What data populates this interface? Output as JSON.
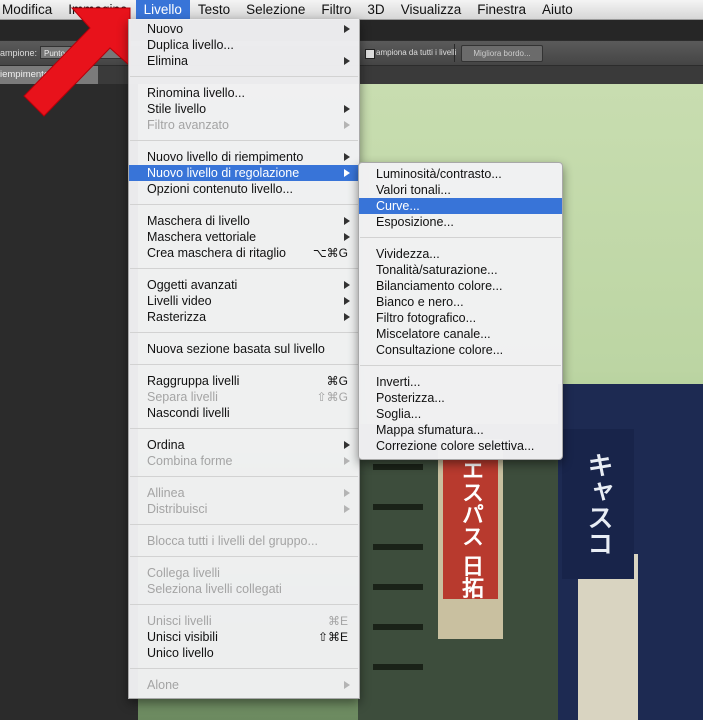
{
  "menubar": {
    "items": [
      "Modifica",
      "Immagine",
      "Livello",
      "Testo",
      "Selezione",
      "Filtro",
      "3D",
      "Visualizza",
      "Finestra",
      "Aiuto"
    ],
    "active": "Livello"
  },
  "options_bar": {
    "sample_label": "ampione:",
    "sample_value": "Punto ca",
    "all_layers_label": "ampiona da tutti i livelli",
    "refine_edge_button": "Migliora bordo..."
  },
  "doc_tab": {
    "title": "iempimento 1"
  },
  "layer_menu": {
    "items": [
      {
        "label": "Nuovo",
        "submenu": true
      },
      {
        "label": "Duplica livello..."
      },
      {
        "label": "Elimina",
        "submenu": true
      },
      {
        "separator": true
      },
      {
        "label": "Rinomina livello..."
      },
      {
        "label": "Stile livello",
        "submenu": true
      },
      {
        "label": "Filtro avanzato",
        "submenu": true,
        "disabled": true
      },
      {
        "separator": true
      },
      {
        "label": "Nuovo livello di riempimento",
        "submenu": true
      },
      {
        "label": "Nuovo livello di regolazione",
        "submenu": true,
        "highlighted": true
      },
      {
        "label": "Opzioni contenuto livello..."
      },
      {
        "separator": true
      },
      {
        "label": "Maschera di livello",
        "submenu": true
      },
      {
        "label": "Maschera vettoriale",
        "submenu": true
      },
      {
        "label": "Crea maschera di ritaglio",
        "shortcut": "⌥⌘G"
      },
      {
        "separator": true
      },
      {
        "label": "Oggetti avanzati",
        "submenu": true
      },
      {
        "label": "Livelli video",
        "submenu": true
      },
      {
        "label": "Rasterizza",
        "submenu": true
      },
      {
        "separator": true
      },
      {
        "label": "Nuova sezione basata sul livello"
      },
      {
        "separator": true
      },
      {
        "label": "Raggruppa livelli",
        "shortcut": "⌘G"
      },
      {
        "label": "Separa livelli",
        "shortcut": "⇧⌘G",
        "disabled": true
      },
      {
        "label": "Nascondi livelli"
      },
      {
        "separator": true
      },
      {
        "label": "Ordina",
        "submenu": true
      },
      {
        "label": "Combina forme",
        "submenu": true,
        "disabled": true
      },
      {
        "separator": true
      },
      {
        "label": "Allinea",
        "submenu": true,
        "disabled": true
      },
      {
        "label": "Distribuisci",
        "submenu": true,
        "disabled": true
      },
      {
        "separator": true
      },
      {
        "label": "Blocca tutti i livelli del gruppo...",
        "disabled": true
      },
      {
        "separator": true
      },
      {
        "label": "Collega livelli",
        "disabled": true
      },
      {
        "label": "Seleziona livelli collegati",
        "disabled": true
      },
      {
        "separator": true
      },
      {
        "label": "Unisci livelli",
        "shortcut": "⌘E",
        "disabled": true
      },
      {
        "label": "Unisci visibili",
        "shortcut": "⇧⌘E"
      },
      {
        "label": "Unico livello"
      },
      {
        "separator": true
      },
      {
        "label": "Alone",
        "submenu": true,
        "disabled": true
      }
    ]
  },
  "adjustment_submenu": {
    "items": [
      {
        "label": "Luminosità/contrasto..."
      },
      {
        "label": "Valori tonali..."
      },
      {
        "label": "Curve...",
        "highlighted": true
      },
      {
        "label": "Esposizione..."
      },
      {
        "separator": true
      },
      {
        "label": "Vividezza..."
      },
      {
        "label": "Tonalità/saturazione..."
      },
      {
        "label": "Bilanciamento colore..."
      },
      {
        "label": "Bianco e nero..."
      },
      {
        "label": "Filtro fotografico..."
      },
      {
        "label": "Miscelatore canale..."
      },
      {
        "label": "Consultazione colore..."
      },
      {
        "separator": true
      },
      {
        "label": "Inverti..."
      },
      {
        "label": "Posterizza..."
      },
      {
        "label": "Soglia..."
      },
      {
        "label": "Mappa sfumatura..."
      },
      {
        "label": "Correzione colore selettiva..."
      }
    ]
  },
  "photo_signs": {
    "red_sign": "エスパス 日拓",
    "blue_sign": "キャスコ"
  },
  "colors": {
    "highlight": "#3874d8",
    "arrow": "#e8121b"
  }
}
